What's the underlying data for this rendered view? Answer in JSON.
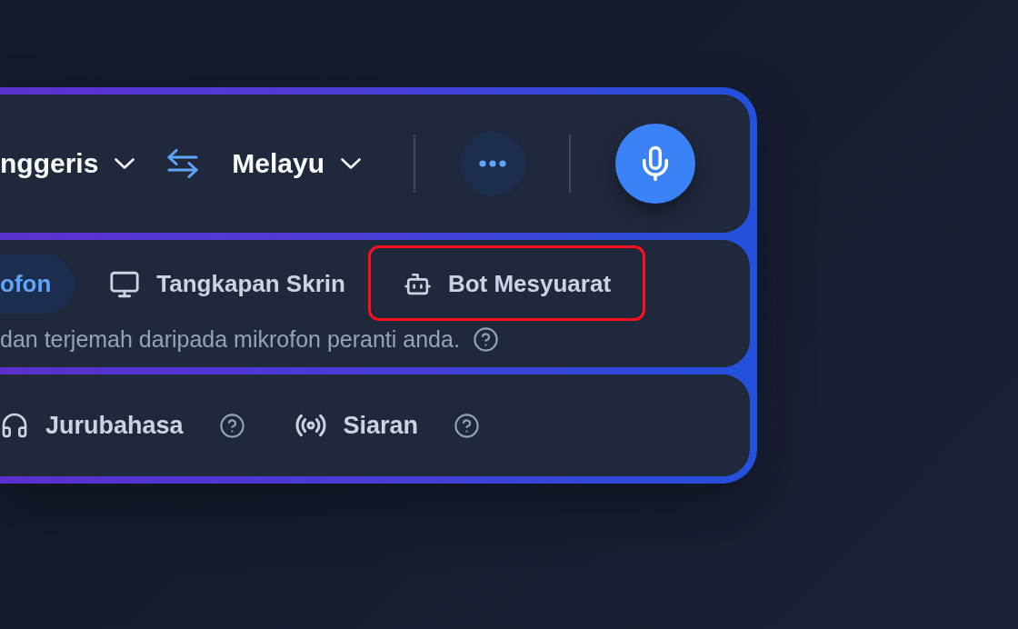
{
  "language_bar": {
    "source_language": "nggeris",
    "target_language": "Melayu"
  },
  "source_tabs": [
    {
      "label": "ofon",
      "kind": "plain",
      "selected": true,
      "highlighted": false
    },
    {
      "label": "Tangkapan Skrin",
      "kind": "screen",
      "selected": false,
      "highlighted": false
    },
    {
      "label": "Bot Mesyuarat",
      "kind": "bot",
      "selected": false,
      "highlighted": true
    }
  ],
  "source_description": "dan terjemah daripada mikrofon peranti anda.",
  "modes": [
    {
      "label": "Jurubahasa",
      "kind": "headphones"
    },
    {
      "label": "Siaran",
      "kind": "broadcast"
    }
  ]
}
